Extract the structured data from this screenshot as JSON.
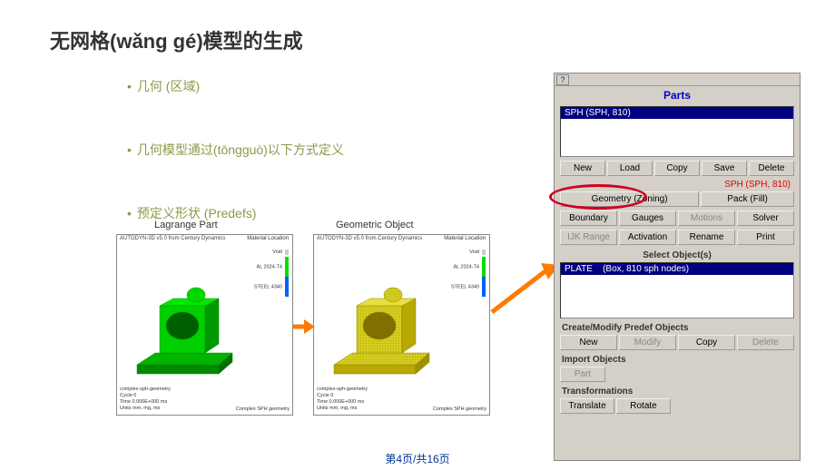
{
  "title": "无网格(wǎng gé)模型的生成",
  "bullets": {
    "b1": "几何 (区域)",
    "b2": "几何模型通过(tōngguò)以下方式定义",
    "b3": "预定义形状 (Predefs)"
  },
  "figLabels": {
    "left": "Lagrange Part",
    "right": "Geometric Object"
  },
  "fig": {
    "header": "AUTODYN-3D v5.0 from Century Dynamics",
    "material": "Material Location",
    "legend": {
      "void": "Void",
      "al": "AL 2024-T4",
      "steel": "STEEL 4340"
    },
    "footer": {
      "l1": "complex-sph-geometry",
      "l2": "Cycle 0",
      "l3": "Time 0.000E+000 ms",
      "l4": "Units mm, mg, ms",
      "right": "Complex SPH geometry"
    }
  },
  "panel": {
    "help": "?",
    "title": "Parts",
    "list1": "SPH (SPH, 810)",
    "row1": {
      "new": "New",
      "load": "Load",
      "copy": "Copy",
      "save": "Save",
      "delete": "Delete"
    },
    "ghost": "SPH (SPH, 810)",
    "row2": {
      "geom": "Geometry (Zoning)",
      "pack": "Pack (Fill)"
    },
    "row3": {
      "boundary": "Boundary",
      "gauges": "Gauges",
      "motions": "Motions",
      "solver": "Solver"
    },
    "row4": {
      "ijk": "IJK Range",
      "activation": "Activation",
      "rename": "Rename",
      "print": "Print"
    },
    "selectObjects": "Select Object(s)",
    "list2a": "PLATE",
    "list2b": "(Box, 810 sph nodes)",
    "createModify": "Create/Modify Predef Objects",
    "row5": {
      "new": "New",
      "modify": "Modify",
      "copy": "Copy",
      "delete": "Delete"
    },
    "importObjects": "Import Objects",
    "row6": {
      "part": "Part"
    },
    "transformations": "Transformations",
    "row7": {
      "translate": "Translate",
      "rotate": "Rotate"
    }
  },
  "pager": "第4页/共16页"
}
